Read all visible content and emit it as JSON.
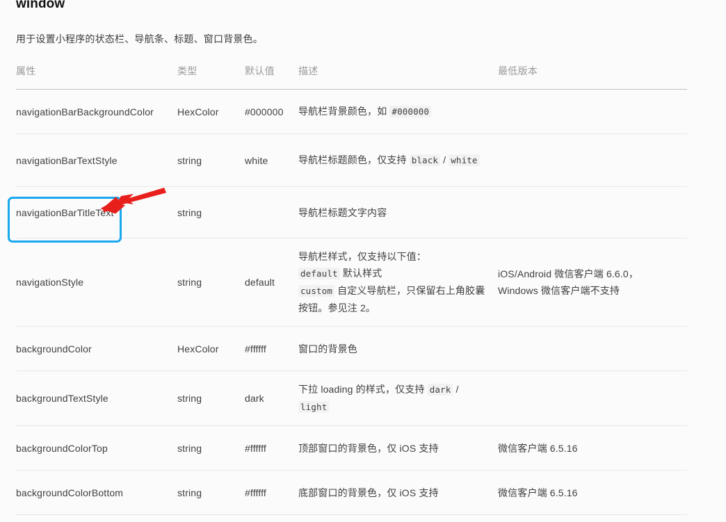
{
  "page": {
    "title": "window",
    "intro": "用于设置小程序的状态栏、导航条、标题、窗口背景色。"
  },
  "table": {
    "headers": {
      "attr": "属性",
      "type": "类型",
      "default": "默认值",
      "desc": "描述",
      "version": "最低版本"
    },
    "rows": [
      {
        "attr": "navigationBarBackgroundColor",
        "type": "HexColor",
        "default": "#000000",
        "desc_pre": "导航栏背景颜色，如",
        "desc_code": "#000000",
        "desc_post": "",
        "version": ""
      },
      {
        "attr": "navigationBarTextStyle",
        "type": "string",
        "default": "white",
        "desc_pre": "导航栏标题颜色，仅支持",
        "desc_code": "black",
        "desc_mid": "/",
        "desc_code2": "white",
        "version": ""
      },
      {
        "attr": "navigationBarTitleText",
        "type": "string",
        "default": "",
        "desc_pre": "导航栏标题文字内容",
        "version": ""
      },
      {
        "attr": "navigationStyle",
        "type": "string",
        "default": "default",
        "desc_line1": "导航栏样式，仅支持以下值：",
        "desc_code_a": "default",
        "desc_line2": "默认样式",
        "desc_code_b": "custom",
        "desc_line3": "自定义导航栏，只保留右上角胶囊按钮。参见注 2。",
        "version_line1": "iOS/Android 微信客户端 6.6.0，",
        "version_line2": "Windows 微信客户端不支持"
      },
      {
        "attr": "backgroundColor",
        "type": "HexColor",
        "default": "#ffffff",
        "desc_pre": "窗口的背景色",
        "version": ""
      },
      {
        "attr": "backgroundTextStyle",
        "type": "string",
        "default": "dark",
        "desc_pre": "下拉 loading 的样式，仅支持",
        "desc_code": "dark",
        "desc_mid": "/",
        "desc_code2": "light",
        "version": ""
      },
      {
        "attr": "backgroundColorTop",
        "type": "string",
        "default": "#ffffff",
        "desc_pre": "顶部窗口的背景色，仅 iOS 支持",
        "version": "微信客户端 6.5.16"
      },
      {
        "attr": "backgroundColorBottom",
        "type": "string",
        "default": "#ffffff",
        "desc_pre": "底部窗口的背景色，仅 iOS 支持",
        "version": "微信客户端 6.5.16"
      }
    ]
  },
  "annotations": {
    "highlight_box": {
      "target": "navigationBarTitleText",
      "color": "#18a8f0"
    },
    "arrow": {
      "color": "#e8201c",
      "points_to": "navigationBarTitleText"
    }
  }
}
